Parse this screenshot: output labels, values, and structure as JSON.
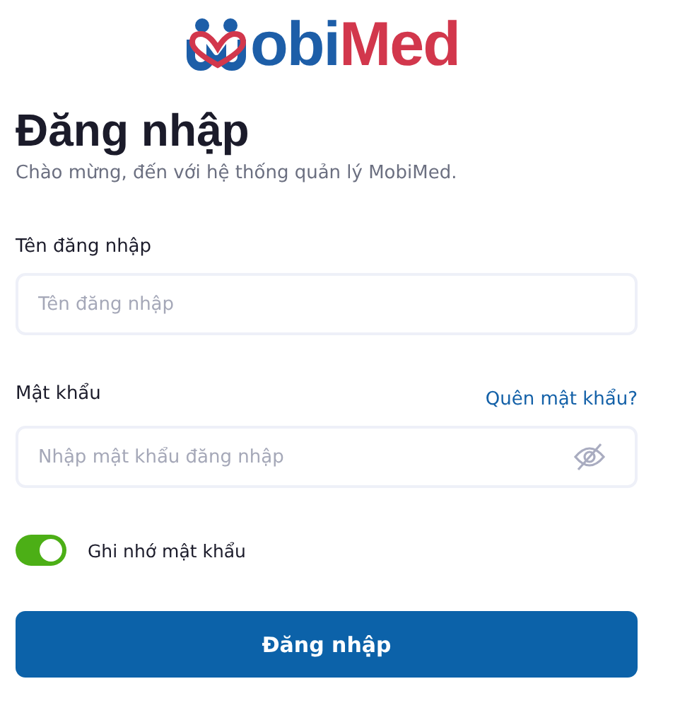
{
  "logo": {
    "parts": [
      {
        "text": "obi",
        "color": "#1d5ea8"
      },
      {
        "text": "Med",
        "color": "#d2374c"
      }
    ]
  },
  "title": "Đăng nhập",
  "subtitle": "Chào mừng, đến với hệ thống quản lý MobiMed.",
  "username": {
    "label": "Tên đăng nhập",
    "placeholder": "Tên đăng nhập"
  },
  "password": {
    "label": "Mật khẩu",
    "forgot_link": "Quên mật khẩu?",
    "placeholder": "Nhập mật khẩu đăng nhập",
    "visible": false
  },
  "remember": {
    "label": "Ghi nhớ mật khẩu",
    "on": true
  },
  "submit": "Đăng nhập"
}
